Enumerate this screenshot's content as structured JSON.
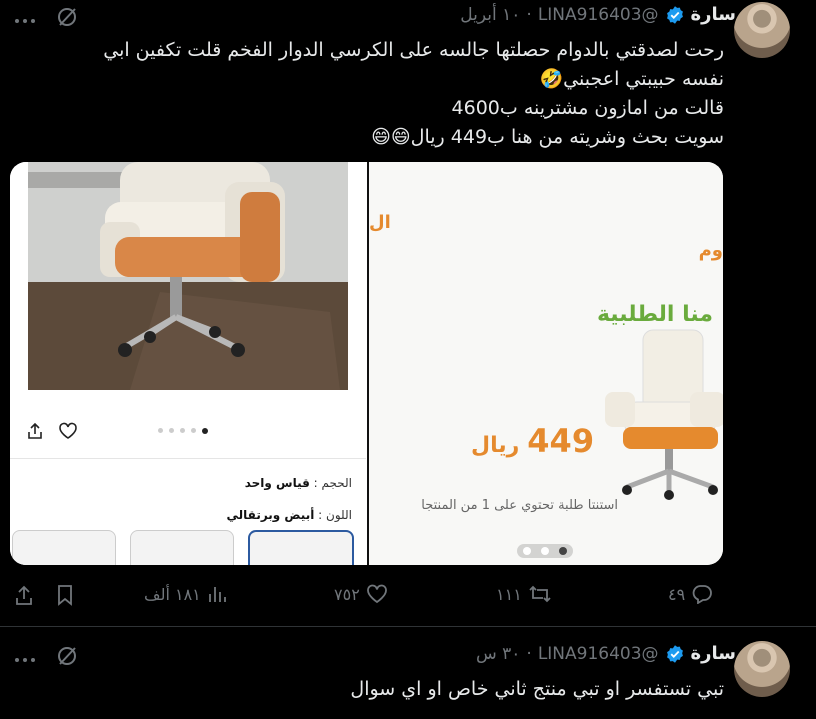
{
  "tweet1": {
    "name": "سارة",
    "handle": "@LINA916403",
    "time": "١٠ أبريل",
    "lines": [
      "رحت لصدقتي بالدوام حصلتها جالسه على الكرسي الدوار الفخم قلت تكفين ابي",
      "نفسه حبيبتي اعجبني🤣",
      "قالت من امازون مشترينه ب4600",
      "سويت بحث وشريته من هنا ب449 ريال😄😄"
    ],
    "media": {
      "left": {
        "size_label": "الحجم :",
        "size_value": "قياس واحد",
        "color_label": "اللون :",
        "color_value": "أبيض وبرتقالي"
      },
      "right": {
        "partial_top": "ال",
        "partial_top2": "وم",
        "heading": "منا الطلبية",
        "price": "449",
        "currency": "ريال",
        "note": "استنتا طلبة تحتوي على 1 من المنتجا"
      }
    },
    "actions": {
      "replies": "٤٩",
      "retweets": "١١١",
      "likes": "٧٥٢",
      "views": "١٨١ ألف"
    }
  },
  "tweet2": {
    "name": "سارة",
    "handle": "@LINA916403",
    "time": "٣٠ س",
    "text": "تبي تستفسر او تبي منتج ثاني خاص او اي سوال"
  },
  "colors": {
    "background": "#000000",
    "text": "#e7e9ea",
    "muted": "#71767b",
    "verified": "#1d9bf0",
    "orange": "#e58a2e",
    "green": "#6aab3d"
  },
  "icons": [
    "more-icon",
    "grok-icon",
    "verified-icon",
    "reply-icon",
    "retweet-icon",
    "like-icon",
    "views-icon",
    "bookmark-icon",
    "share-icon"
  ]
}
